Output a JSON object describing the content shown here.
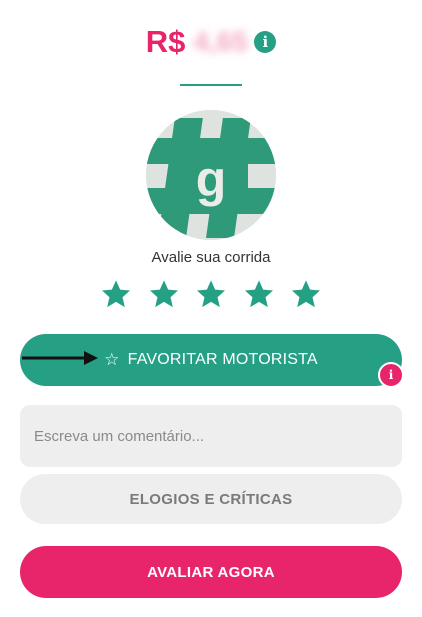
{
  "price": {
    "currency": "R$",
    "amount_obscured": "4,65",
    "info_icon": "info-icon"
  },
  "driver": {
    "avatar_icon": "driver-avatar-g-logo",
    "avatar_letter": "g"
  },
  "rating": {
    "label": "Avalie sua corrida",
    "stars_selected": 5,
    "stars_total": 5
  },
  "favorite": {
    "label": "FAVORITAR MOTORISTA",
    "icon": "star-outline-icon",
    "annotation_icon": "arrow-pointer-icon",
    "badge_icon": "alert-info-icon"
  },
  "comment": {
    "placeholder": "Escreva um comentário...",
    "value": ""
  },
  "feedback": {
    "label": "ELOGIOS E CRÍTICAS"
  },
  "submit": {
    "label": "AVALIAR AGORA"
  },
  "colors": {
    "accent_green": "#26a085",
    "accent_pink": "#e8256b",
    "field_gray": "#eeeeee"
  }
}
